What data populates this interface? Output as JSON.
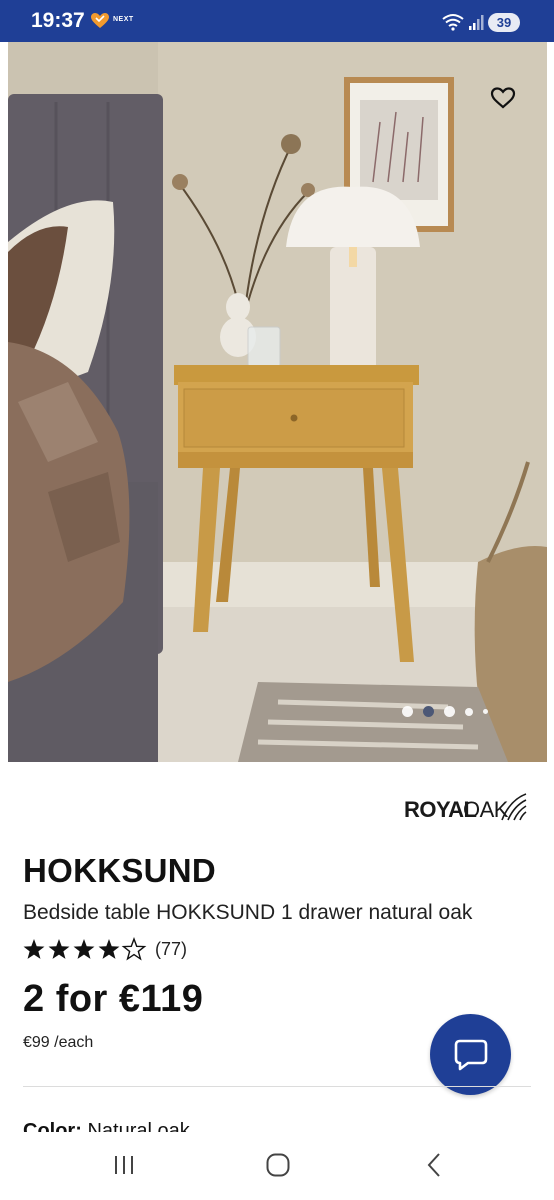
{
  "status_bar": {
    "time": "19:37",
    "notification_app": "NEXT",
    "battery_level": "39",
    "icons": [
      "heart-icon",
      "wifi-icon",
      "signal-icon",
      "battery-icon"
    ]
  },
  "gallery": {
    "slide_count": 5,
    "active_slide": 2,
    "favorite_icon": "heart-outline-icon"
  },
  "brand": {
    "name_bold": "ROYAL",
    "name_light": "OAK"
  },
  "product": {
    "title": "HOKKSUND",
    "subtitle": "Bedside table HOKKSUND 1 drawer natural oak",
    "rating_stars": 4,
    "rating_max": 5,
    "review_count": "(77)",
    "price_main": "2 for €119",
    "price_each": "€99 /each",
    "color_label": "Color:",
    "color_value": "Natural oak"
  },
  "chat": {
    "icon": "chat-bubble-icon"
  },
  "nav_bar": {
    "icons": [
      "recents-icon",
      "home-icon",
      "back-icon"
    ]
  },
  "colors": {
    "brand_blue": "#1f3f96",
    "text": "#111111"
  }
}
